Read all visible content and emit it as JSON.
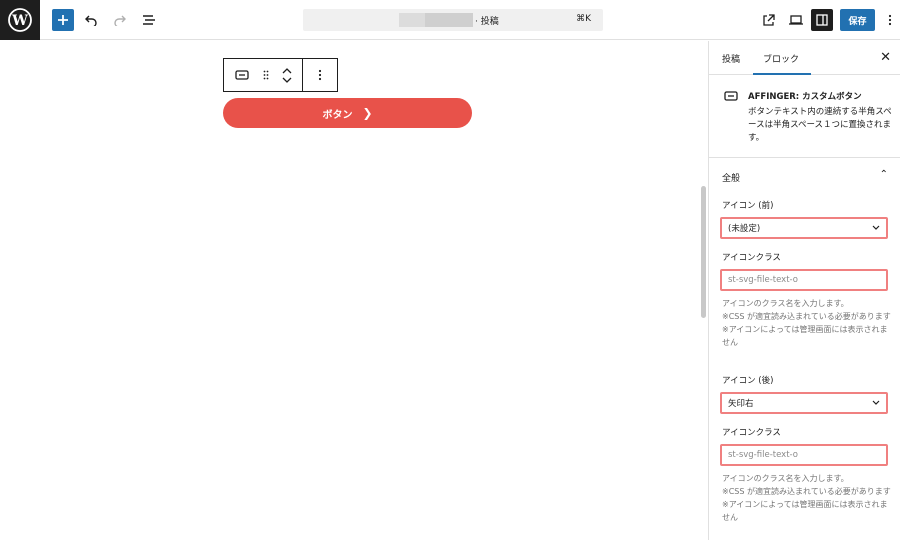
{
  "topbar": {
    "command_title": "· 投稿",
    "command_shortcut": "⌘K",
    "save_label": "保存"
  },
  "block_button": {
    "label": "ボタン",
    "arrow": "❯"
  },
  "sidebar": {
    "tabs": [
      "投稿",
      "ブロック"
    ],
    "close": "✕",
    "block_card": {
      "title": "AFFINGER: カスタムボタン",
      "description": "ボタンテキスト内の連続する半角スペースは半角スペース１つに置換されます。"
    },
    "section": {
      "title": "全般",
      "toggle": "⌃"
    },
    "fields": {
      "icon_before_label": "アイコン (前)",
      "icon_before_value": "(未設定)",
      "icon_class_label_1": "アイコンクラス",
      "icon_class_placeholder_1": "st-svg-file-text-o",
      "help_1_line1": "アイコンのクラス名を入力します。",
      "help_1_line2": "※CSS が適宜読み込まれている必要があります",
      "help_1_line3": "※アイコンによっては管理画面には表示されません",
      "icon_after_label": "アイコン (後)",
      "icon_after_value": "矢印右",
      "icon_class_label_2": "アイコンクラス",
      "icon_class_placeholder_2": "st-svg-file-text-o",
      "help_2_line1": "アイコンのクラス名を入力します。",
      "help_2_line2": "※CSS が適宜読み込まれている必要があります",
      "help_2_line3": "※アイコンによっては管理画面には表示されません"
    }
  },
  "colors": {
    "accent": "#2271b1",
    "button": "#e8524a",
    "highlight": "#f08080"
  }
}
